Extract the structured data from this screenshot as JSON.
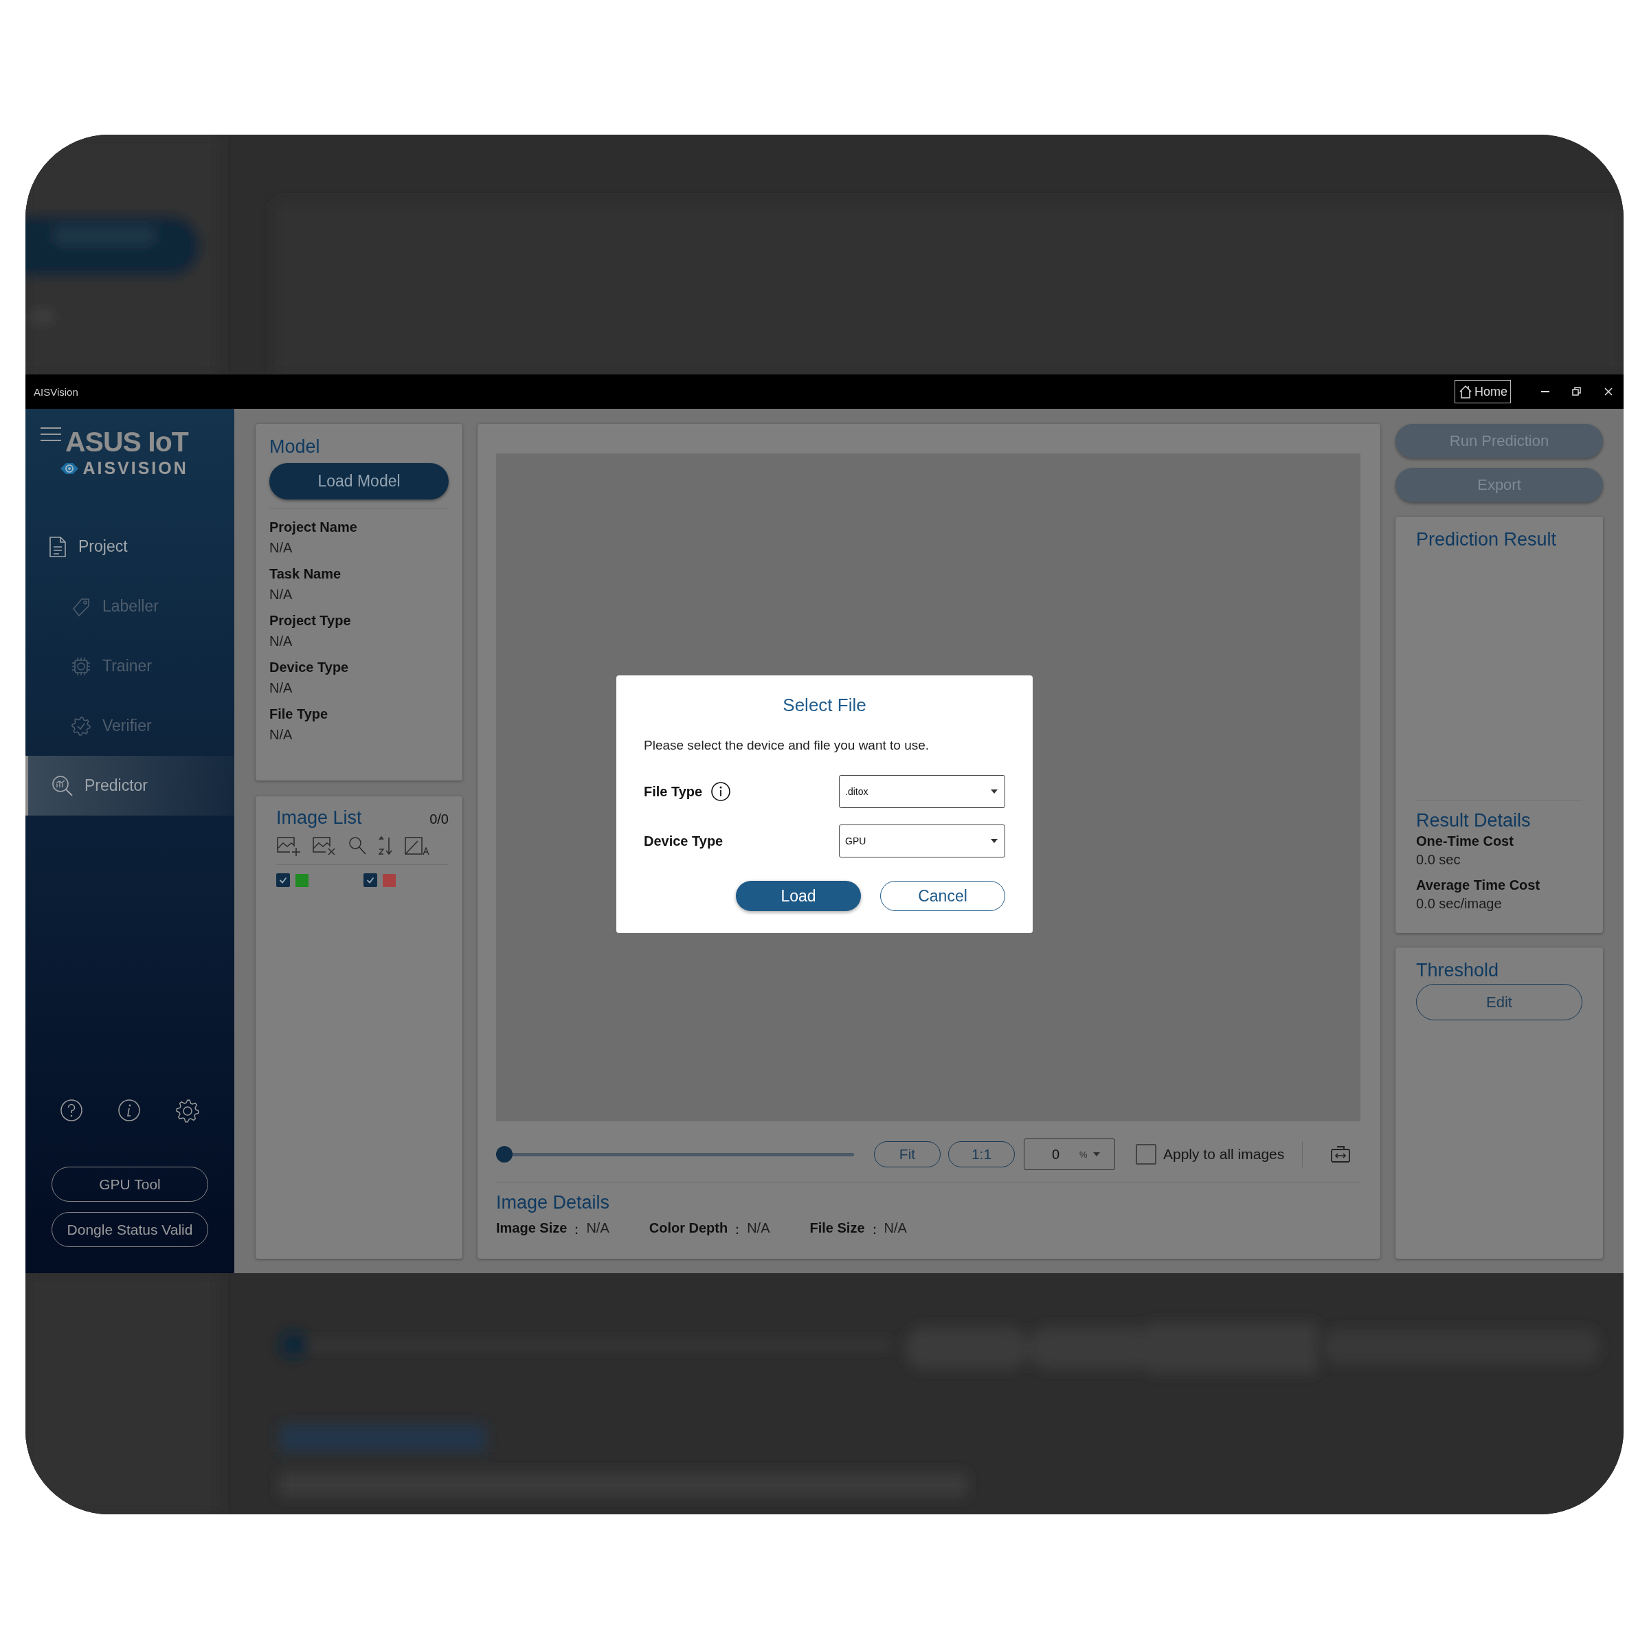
{
  "window": {
    "title": "AISVision",
    "home_button": "Home"
  },
  "sidebar": {
    "logo_text": "ASUS IoT",
    "logo_subtext": "AISVISION",
    "nav": [
      {
        "label": "Project",
        "selected": false,
        "disabled": false,
        "children": [
          {
            "label": "Labeller",
            "selected": false,
            "disabled": true
          },
          {
            "label": "Trainer",
            "selected": false,
            "disabled": true
          },
          {
            "label": "Verifier",
            "selected": false,
            "disabled": true
          }
        ]
      },
      {
        "label": "Predictor",
        "selected": true,
        "disabled": false
      }
    ],
    "buttons": [
      "GPU Tool",
      "Dongle Status Valid"
    ]
  },
  "model_panel": {
    "title": "Model",
    "button": "Load Model",
    "fields": [
      {
        "label": "Project Name",
        "value": "N/A"
      },
      {
        "label": "Task Name",
        "value": "N/A"
      },
      {
        "label": "Project Type",
        "value": "N/A"
      },
      {
        "label": "Device Type",
        "value": "N/A"
      },
      {
        "label": "File Type",
        "value": "N/A"
      }
    ]
  },
  "image_list": {
    "title": "Image List",
    "count": "0/0",
    "filters": [
      {
        "checked": true,
        "color": "#1f8a22"
      },
      {
        "checked": true,
        "color": "#a84242"
      }
    ]
  },
  "viewer": {
    "zoom_slider": {
      "level": 0
    },
    "buttons": [
      "Fit",
      "1:1"
    ],
    "zoom_value": "0",
    "zoom_unit": "%",
    "apply_all": {
      "label": "Apply to all images",
      "checked": false
    }
  },
  "image_details": {
    "title": "Image Details",
    "separator": "：",
    "items": [
      {
        "label": "Image Size",
        "value": "N/A"
      },
      {
        "label": "Color Depth",
        "value": "N/A"
      },
      {
        "label": "File Size",
        "value": "N/A"
      }
    ]
  },
  "actions": [
    {
      "label": "Run Prediction",
      "disabled": true
    },
    {
      "label": "Export",
      "disabled": true
    }
  ],
  "prediction_result": {
    "title": "Prediction Result"
  },
  "result_details": {
    "title": "Result Details",
    "items": [
      {
        "label": "One-Time Cost",
        "value": "0.0 sec"
      },
      {
        "label": "Average Time Cost",
        "value": "0.0 sec/image"
      }
    ]
  },
  "threshold": {
    "title": "Threshold",
    "button": "Edit"
  },
  "dialog": {
    "title": "Select File",
    "message": "Please select the device and file you want to use.",
    "fields": [
      {
        "label": "File Type",
        "info": true,
        "value": ".ditox"
      },
      {
        "label": "Device Type",
        "info": false,
        "value": "GPU"
      }
    ],
    "buttons": [
      {
        "label": "Load",
        "kind": "primary"
      },
      {
        "label": "Cancel",
        "kind": "secondary"
      }
    ]
  }
}
